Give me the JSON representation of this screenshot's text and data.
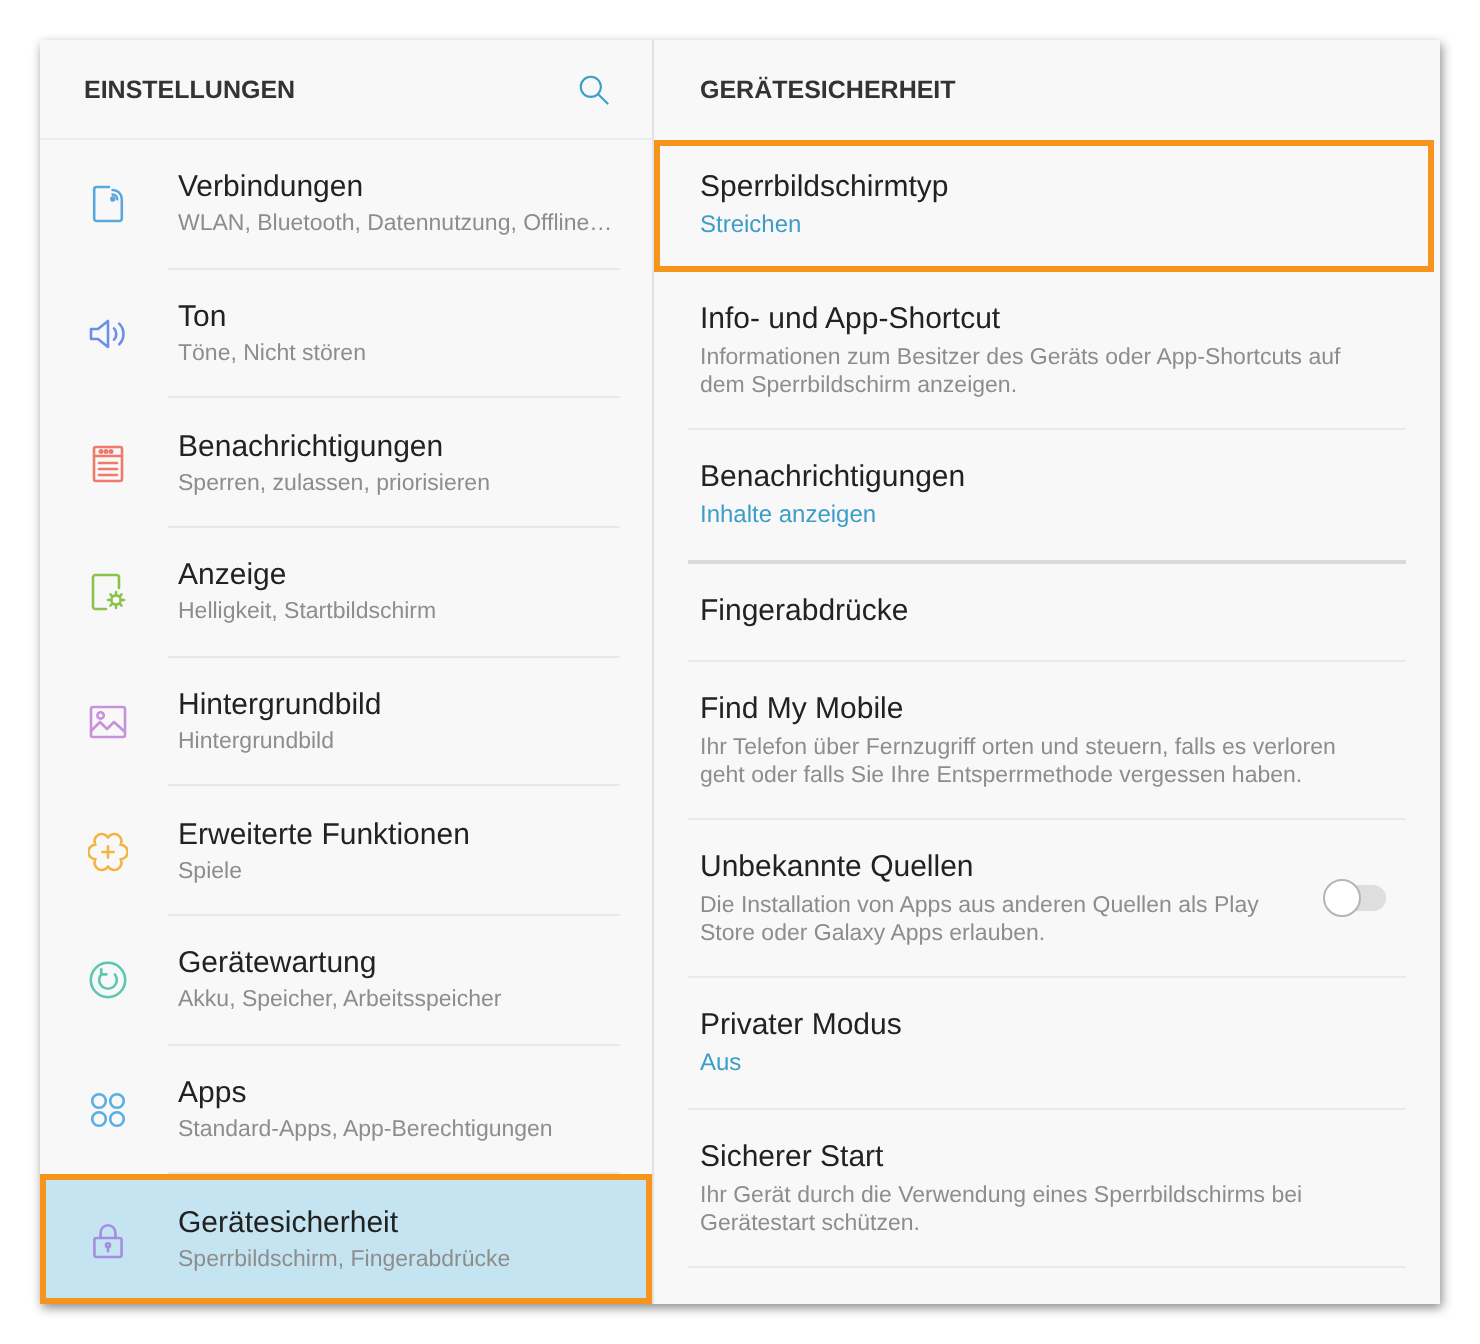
{
  "sidebar": {
    "title": "EINSTELLUNGEN",
    "items": [
      {
        "title": "Verbindungen",
        "subtitle": "WLAN, Bluetooth, Datennutzung, Offline…",
        "selected": false,
        "highlighted": false
      },
      {
        "title": "Ton",
        "subtitle": "Töne, Nicht stören",
        "selected": false,
        "highlighted": false
      },
      {
        "title": "Benachrichtigungen",
        "subtitle": "Sperren, zulassen, priorisieren",
        "selected": false,
        "highlighted": false
      },
      {
        "title": "Anzeige",
        "subtitle": "Helligkeit, Startbildschirm",
        "selected": false,
        "highlighted": false
      },
      {
        "title": "Hintergrundbild",
        "subtitle": "Hintergrundbild",
        "selected": false,
        "highlighted": false
      },
      {
        "title": "Erweiterte Funktionen",
        "subtitle": "Spiele",
        "selected": false,
        "highlighted": false
      },
      {
        "title": "Gerätewartung",
        "subtitle": "Akku, Speicher, Arbeitsspeicher",
        "selected": false,
        "highlighted": false
      },
      {
        "title": "Apps",
        "subtitle": "Standard-Apps, App-Berechtigungen",
        "selected": false,
        "highlighted": false
      },
      {
        "title": "Gerätesicherheit",
        "subtitle": "Sperrbildschirm, Fingerabdrücke",
        "selected": true,
        "highlighted": true
      }
    ]
  },
  "detail": {
    "title": "GERÄTESICHERHEIT",
    "sections": [
      {
        "items": [
          {
            "title": "Sperrbildschirmtyp",
            "value": "Streichen",
            "highlighted": true
          },
          {
            "title": "Info- und App-Shortcut",
            "description": "Informationen zum Besitzer des Geräts oder App-Shortcuts auf dem Sperrbildschirm anzeigen.",
            "highlighted": false
          },
          {
            "title": "Benachrichtigungen",
            "value": "Inhalte anzeigen",
            "highlighted": false
          }
        ]
      },
      {
        "items": [
          {
            "title": "Fingerabdrücke",
            "highlighted": false
          },
          {
            "title": "Find My Mobile",
            "description": "Ihr Telefon über Fernzugriff orten und steuern, falls es verloren geht oder falls Sie Ihre Entsperrmethode vergessen haben.",
            "highlighted": false
          },
          {
            "title": "Unbekannte Quellen",
            "description": "Die Installation von Apps aus anderen Quellen als Play Store oder Galaxy Apps erlauben.",
            "on": false,
            "highlighted": false
          },
          {
            "title": "Privater Modus",
            "value": "Aus",
            "highlighted": false
          },
          {
            "title": "Sicherer Start",
            "description": "Ihr Gerät durch die Verwendung eines Sperrbildschirms bei Gerätestart schützen.",
            "highlighted": false
          }
        ]
      }
    ]
  }
}
